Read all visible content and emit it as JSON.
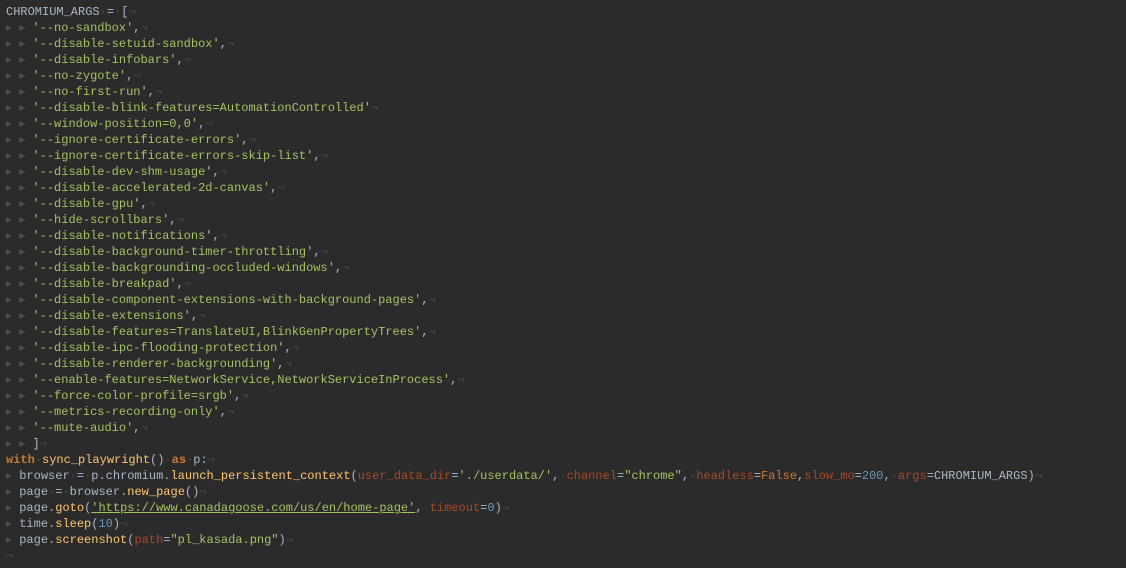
{
  "title_line": {
    "var": "CHROMIUM_ARGS",
    "op": " = ",
    "open": "["
  },
  "args": [
    "'--no-sandbox',",
    "'--disable-setuid-sandbox',",
    "'--disable-infobars',",
    "'--no-zygote',",
    "'--no-first-run',",
    "'--disable-blink-features=AutomationControlled'",
    "'--window-position=0,0',",
    "'--ignore-certificate-errors',",
    "'--ignore-certificate-errors-skip-list',",
    "'--disable-dev-shm-usage',",
    "'--disable-accelerated-2d-canvas',",
    "'--disable-gpu',",
    "'--hide-scrollbars',",
    "'--disable-notifications',",
    "'--disable-background-timer-throttling',",
    "'--disable-backgrounding-occluded-windows',",
    "'--disable-breakpad',",
    "'--disable-component-extensions-with-background-pages',",
    "'--disable-extensions',",
    "'--disable-features=TranslateUI,BlinkGenPropertyTrees',",
    "'--disable-ipc-flooding-protection',",
    "'--disable-renderer-backgrounding',",
    "'--enable-features=NetworkService,NetworkServiceInProcess',",
    "'--force-color-profile=srgb',",
    "'--metrics-recording-only',",
    "'--mute-audio',"
  ],
  "close_line": "]",
  "with_line": {
    "with": "with",
    "expr_fn": "sync_playwright",
    "as": "as",
    "alias": "p",
    "colon": ":"
  },
  "body": [
    {
      "kind": "assign",
      "lhs": "browser",
      "rhs": [
        {
          "t": "ident",
          "v": "p"
        },
        {
          "t": "op",
          "v": "."
        },
        {
          "t": "ident",
          "v": "chromium"
        },
        {
          "t": "op",
          "v": "."
        },
        {
          "t": "fn",
          "v": "launch_persistent_context"
        },
        {
          "t": "paren",
          "v": "("
        },
        {
          "t": "param",
          "v": "user_data_dir"
        },
        {
          "t": "op",
          "v": "="
        },
        {
          "t": "string",
          "v": "'./userdata/'"
        },
        {
          "t": "op",
          "v": ", "
        },
        {
          "t": "param",
          "v": "channel"
        },
        {
          "t": "op",
          "v": "="
        },
        {
          "t": "string",
          "v": "\"chrome\""
        },
        {
          "t": "op",
          "v": ", "
        },
        {
          "t": "param",
          "v": "headless"
        },
        {
          "t": "op",
          "v": "="
        },
        {
          "t": "bool",
          "v": "False"
        },
        {
          "t": "op",
          "v": ","
        },
        {
          "t": "param",
          "v": "slow_mo"
        },
        {
          "t": "op",
          "v": "="
        },
        {
          "t": "num",
          "v": "200"
        },
        {
          "t": "op",
          "v": ", "
        },
        {
          "t": "param",
          "v": "args"
        },
        {
          "t": "op",
          "v": "="
        },
        {
          "t": "const",
          "v": "CHROMIUM_ARGS"
        },
        {
          "t": "paren",
          "v": ")"
        }
      ]
    },
    {
      "kind": "assign",
      "lhs": "page",
      "rhs": [
        {
          "t": "ident",
          "v": "browser"
        },
        {
          "t": "op",
          "v": "."
        },
        {
          "t": "fn",
          "v": "new_page"
        },
        {
          "t": "paren",
          "v": "()"
        }
      ]
    },
    {
      "kind": "call",
      "rhs": [
        {
          "t": "ident",
          "v": "page"
        },
        {
          "t": "op",
          "v": "."
        },
        {
          "t": "fn",
          "v": "goto"
        },
        {
          "t": "paren",
          "v": "("
        },
        {
          "t": "string-url",
          "v": "'https://www.canadagoose.com/us/en/home-page'"
        },
        {
          "t": "op",
          "v": ", "
        },
        {
          "t": "param",
          "v": "timeout"
        },
        {
          "t": "op",
          "v": "="
        },
        {
          "t": "num",
          "v": "0"
        },
        {
          "t": "paren",
          "v": ")"
        }
      ]
    },
    {
      "kind": "call",
      "rhs": [
        {
          "t": "ident",
          "v": "time"
        },
        {
          "t": "op",
          "v": "."
        },
        {
          "t": "fn",
          "v": "sleep"
        },
        {
          "t": "paren",
          "v": "("
        },
        {
          "t": "num",
          "v": "10"
        },
        {
          "t": "paren",
          "v": ")"
        }
      ]
    },
    {
      "kind": "call",
      "rhs": [
        {
          "t": "ident",
          "v": "page"
        },
        {
          "t": "op",
          "v": "."
        },
        {
          "t": "fn",
          "v": "screenshot"
        },
        {
          "t": "paren",
          "v": "("
        },
        {
          "t": "param",
          "v": "path"
        },
        {
          "t": "op",
          "v": "="
        },
        {
          "t": "string",
          "v": "\"pl_kasada.png\""
        },
        {
          "t": "paren",
          "v": ")"
        }
      ]
    }
  ],
  "glyphs": {
    "indent2": "▸   ▸   ",
    "indent1": "▸   ",
    "indent1_close": "▸   ▸   ",
    "dot": "·",
    "eol": "¬"
  }
}
